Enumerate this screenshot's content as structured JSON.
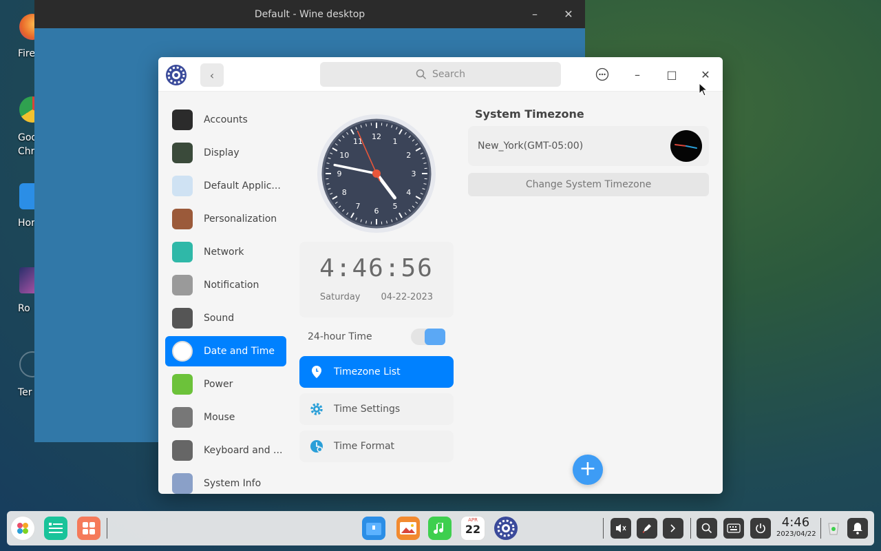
{
  "desktop_icons": [
    {
      "label": "Fire",
      "color": "#e8682a"
    },
    {
      "label": "Goo",
      "label2": "Chro",
      "color": "#d8453a"
    },
    {
      "label": "Hor",
      "color": "#2b8ee6"
    },
    {
      "label": "Ro",
      "color": "#5c4fbf"
    },
    {
      "label": "Ter",
      "color": "transparent"
    }
  ],
  "wine": {
    "title": "Default - Wine desktop",
    "minimize": "–",
    "close": "✕"
  },
  "control_center": {
    "search_placeholder": "Search",
    "back_glyph": "‹",
    "menu_glyph": "⋯",
    "min_glyph": "–",
    "max_glyph": "□",
    "close_glyph": "✕",
    "sidebar": [
      {
        "label": "Accounts",
        "icon": "accounts-icon",
        "color": "#2b2b2b"
      },
      {
        "label": "Display",
        "icon": "display-icon",
        "color": "#3a4a3a"
      },
      {
        "label": "Default Applic...",
        "icon": "default-apps-icon",
        "color": "#cfe2f3"
      },
      {
        "label": "Personalization",
        "icon": "personalization-icon",
        "color": "#9b5a3a"
      },
      {
        "label": "Network",
        "icon": "network-icon",
        "color": "#2fb8a8"
      },
      {
        "label": "Notification",
        "icon": "notification-icon",
        "color": "#9a9a9a"
      },
      {
        "label": "Sound",
        "icon": "sound-icon",
        "color": "#555"
      },
      {
        "label": "Date and Time",
        "icon": "clock-icon",
        "color": "#ffffff"
      },
      {
        "label": "Power",
        "icon": "battery-icon",
        "color": "#6cc23a"
      },
      {
        "label": "Mouse",
        "icon": "mouse-icon",
        "color": "#777"
      },
      {
        "label": "Keyboard and ...",
        "icon": "keyboard-icon",
        "color": "#666"
      },
      {
        "label": "System Info",
        "icon": "system-info-icon",
        "color": "#8aa0c8"
      }
    ],
    "active_item": "Date and Time",
    "digital_time": "4:46:56",
    "weekday": "Saturday",
    "date": "04-22-2023",
    "hour24_label": "24-hour Time",
    "hour24_on": true,
    "mid_items": [
      {
        "label": "Timezone List",
        "icon": "location-pin-icon",
        "active": true
      },
      {
        "label": "Time Settings",
        "icon": "gear-icon",
        "active": false
      },
      {
        "label": "Time Format",
        "icon": "time-format-icon",
        "active": false
      }
    ],
    "timezone_title": "System Timezone",
    "timezone_value": "New_York(GMT-05:00)",
    "change_button": "Change System Timezone",
    "add_glyph": "+"
  },
  "analog_clock": {
    "hours": 4,
    "minutes": 46,
    "seconds": 56,
    "numbers": [
      "12",
      "1",
      "2",
      "3",
      "4",
      "5",
      "6",
      "7",
      "8",
      "9",
      "10",
      "11"
    ]
  },
  "dock": {
    "time": "4:46",
    "date": "2023/04/22",
    "calendar_day": "22",
    "calendar_month": "APR"
  }
}
